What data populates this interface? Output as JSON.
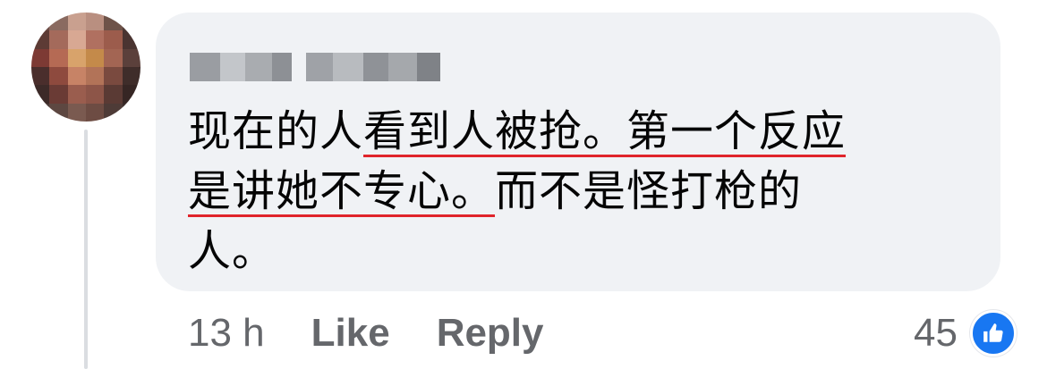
{
  "comment": {
    "avatar_icon": "pixelated-avatar",
    "author_name": "",
    "text_line1_a": "现在的人",
    "text_line1_b": "看到人被抢。第一个反应",
    "text_line2_a": "是讲她不专心。",
    "text_line2_b": "而不是怪打枪的",
    "text_line3": "人。",
    "underline_color": "#e0242b"
  },
  "actions": {
    "timestamp": "13 h",
    "like_label": "Like",
    "reply_label": "Reply"
  },
  "reactions": {
    "count": "45",
    "icon": "thumbs-up-icon",
    "icon_color": "#1877f2"
  },
  "colors": {
    "bubble": "#f0f2f5",
    "secondary_text": "#65676b",
    "primary_text": "#050505"
  }
}
